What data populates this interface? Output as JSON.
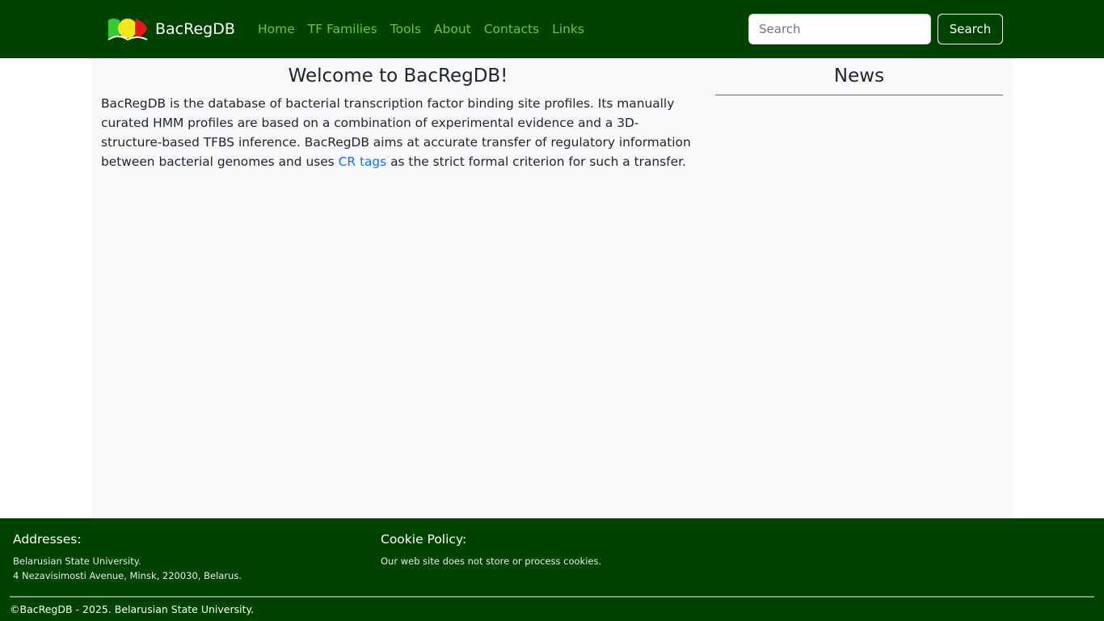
{
  "navbar": {
    "brand": "BacRegDB",
    "links": [
      "Home",
      "TF Families",
      "Tools",
      "About",
      "Contacts",
      "Links"
    ],
    "search_placeholder": "Search",
    "search_button": "Search"
  },
  "main": {
    "welcome_title": "Welcome to BacRegDB!",
    "intro_before_link": "BacRegDB is the database of bacterial transcription factor binding site profiles. Its manually curated HMM profiles are based on a combination of experimental evidence and a 3D-structure-based TFBS inference. BacRegDB aims at accurate transfer of regulatory information between bacterial genomes and uses ",
    "intro_link": "CR tags",
    "intro_after_link": " as the strict formal criterion for such a transfer.",
    "news_title": "News"
  },
  "footer": {
    "addresses_heading": "Addresses:",
    "address_line1": "Belarusian State University.",
    "address_line2": "4 Nezavisimosti Avenue, Minsk, 220030, Belarus.",
    "cookie_heading": "Cookie Policy:",
    "cookie_text": "Our web site does not store or process cookies.",
    "copyright": "©BacRegDB - 2025. Belarusian State University."
  },
  "colors": {
    "navbar_bg": "#004300",
    "nav_link": "#6ec43a",
    "link": "#0d6efd",
    "main_bg": "#f8f9fa"
  },
  "icons": {
    "logo": "bacregdb-logo-icon"
  }
}
